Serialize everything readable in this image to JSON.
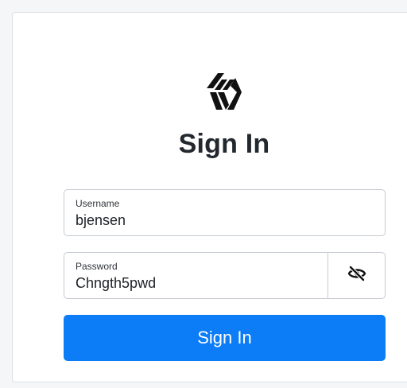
{
  "brand": {
    "logo_icon": "brand-logo-icon"
  },
  "title": "Sign In",
  "username": {
    "label": "Username",
    "value": "bjensen"
  },
  "password": {
    "label": "Password",
    "value": "Chngth5pwd",
    "reveal_icon": "eye-slash-icon"
  },
  "submit": {
    "label": "Sign In",
    "color": "#0c7cf7"
  },
  "colors": {
    "text": "#23282e",
    "border": "#c6cbd1",
    "background": "#f5f6f7"
  }
}
